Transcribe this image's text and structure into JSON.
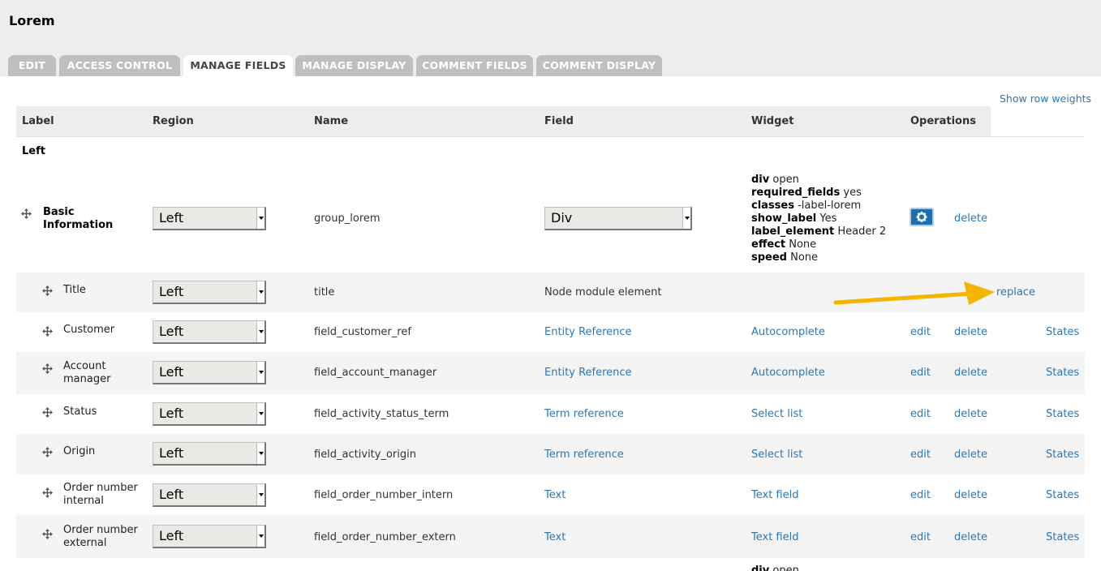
{
  "page": {
    "title": "Lorem"
  },
  "tabs": [
    "EDIT",
    "ACCESS CONTROL",
    "MANAGE FIELDS",
    "MANAGE DISPLAY",
    "COMMENT FIELDS",
    "COMMENT DISPLAY"
  ],
  "active_tab": "MANAGE FIELDS",
  "show_row_weights": "Show row weights",
  "columns": [
    "Label",
    "Region",
    "Name",
    "Field",
    "Widget",
    "Operations"
  ],
  "region": "Left",
  "group": {
    "label": "Basic Information",
    "region": "Left",
    "name": "group_lorem",
    "field": "Div",
    "summary": [
      {
        "key": "div",
        "value": "open"
      },
      {
        "key": "required_fields",
        "value": "yes"
      },
      {
        "key": "classes",
        "value": "-label-lorem"
      },
      {
        "key": "show_label",
        "value": "Yes"
      },
      {
        "key": "label_element",
        "value": "Header 2"
      },
      {
        "key": "effect",
        "value": "None"
      },
      {
        "key": "speed",
        "value": "None"
      }
    ],
    "delete": "delete"
  },
  "title_row": {
    "label": "Title",
    "region": "Left",
    "name": "title",
    "field": "Node module element",
    "operation": "replace"
  },
  "rows": [
    {
      "label": "Customer",
      "region": "Left",
      "name": "field_customer_ref",
      "field": "Entity Reference",
      "widget": "Autocomplete",
      "edit": "edit",
      "delete": "delete",
      "states": "States"
    },
    {
      "label": "Account manager",
      "region": "Left",
      "name": "field_account_manager",
      "field": "Entity Reference",
      "widget": "Autocomplete",
      "edit": "edit",
      "delete": "delete",
      "states": "States"
    },
    {
      "label": "Status",
      "region": "Left",
      "name": "field_activity_status_term",
      "field": "Term reference",
      "widget": "Select list",
      "edit": "edit",
      "delete": "delete",
      "states": "States"
    },
    {
      "label": "Origin",
      "region": "Left",
      "name": "field_activity_origin",
      "field": "Term reference",
      "widget": "Select list",
      "edit": "edit",
      "delete": "delete",
      "states": "States"
    },
    {
      "label": "Order number internal",
      "region": "Left",
      "name": "field_order_number_intern",
      "field": "Text",
      "widget": "Text field",
      "edit": "edit",
      "delete": "delete",
      "states": "States"
    },
    {
      "label": "Order number external",
      "region": "Left",
      "name": "field_order_number_extern",
      "field": "Text",
      "widget": "Text field",
      "edit": "edit",
      "delete": "delete",
      "states": "States"
    }
  ],
  "partial_row": {
    "summary_key": "div",
    "summary_value": "open"
  },
  "colors": {
    "link": "#2a78b8",
    "arrow": "#f5b400",
    "tab_inactive": "#bfbfbf",
    "header_bg": "#ededed",
    "gear_button": "#1d6fb0"
  },
  "icons": {
    "drag": "drag-handle-icon",
    "gear": "gear-icon",
    "arrow": "annotation-arrow-icon"
  }
}
